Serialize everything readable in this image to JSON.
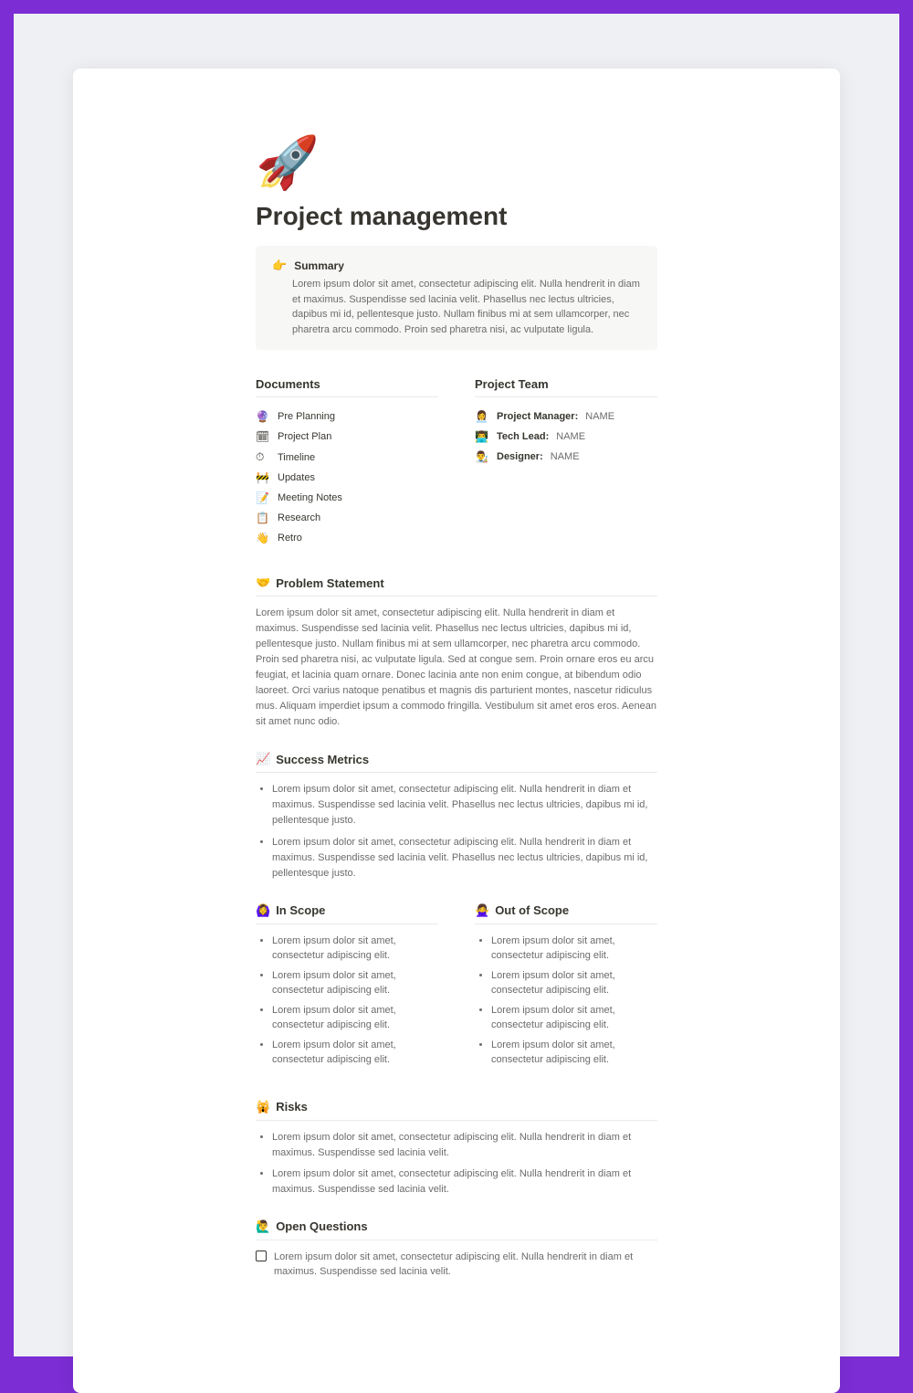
{
  "page": {
    "icon": "🚀",
    "title": "Project management"
  },
  "summary": {
    "icon": "👉",
    "title": "Summary",
    "text": "Lorem ipsum dolor sit amet, consectetur adipiscing elit. Nulla hendrerit in diam et maximus. Suspendisse sed lacinia velit. Phasellus nec lectus ultricies, dapibus mi id, pellentesque justo. Nullam finibus mi at sem ullamcorper, nec pharetra arcu commodo. Proin sed pharetra nisi, ac vulputate ligula."
  },
  "documents": {
    "heading": "Documents",
    "items": [
      {
        "icon": "🔮",
        "label": "Pre Planning"
      },
      {
        "icon": "🗓",
        "label": "Project Plan"
      },
      {
        "icon": "⏱",
        "label": "Timeline"
      },
      {
        "icon": "🚧",
        "label": "Updates"
      },
      {
        "icon": "📝",
        "label": "Meeting Notes"
      },
      {
        "icon": "📋",
        "label": "Research"
      },
      {
        "icon": "👋",
        "label": "Retro"
      }
    ]
  },
  "team": {
    "heading": "Project Team",
    "items": [
      {
        "icon": "👩‍💼",
        "role": "Project Manager:",
        "name": "NAME"
      },
      {
        "icon": "👨‍💻",
        "role": "Tech Lead:",
        "name": "NAME"
      },
      {
        "icon": "👨‍🎨",
        "role": "Designer:",
        "name": "NAME"
      }
    ]
  },
  "problem": {
    "icon": "🤝",
    "heading": "Problem Statement",
    "text": "Lorem ipsum dolor sit amet, consectetur adipiscing elit. Nulla hendrerit in diam et maximus. Suspendisse sed lacinia velit. Phasellus nec lectus ultricies, dapibus mi id, pellentesque justo. Nullam finibus mi at sem ullamcorper, nec pharetra arcu commodo. Proin sed pharetra nisi, ac vulputate ligula. Sed at congue sem. Proin ornare eros eu arcu feugiat, et lacinia quam ornare. Donec lacinia ante non enim congue, at bibendum odio laoreet. Orci varius natoque penatibus et magnis dis parturient montes, nascetur ridiculus mus. Aliquam imperdiet ipsum a commodo fringilla. Vestibulum sit amet eros eros. Aenean sit amet nunc odio."
  },
  "success": {
    "icon": "📈",
    "heading": "Success Metrics",
    "items": [
      "Lorem ipsum dolor sit amet, consectetur adipiscing elit. Nulla hendrerit in diam et maximus. Suspendisse sed lacinia velit. Phasellus nec lectus ultricies, dapibus mi id, pellentesque justo.",
      "Lorem ipsum dolor sit amet, consectetur adipiscing elit. Nulla hendrerit in diam et maximus. Suspendisse sed lacinia velit. Phasellus nec lectus ultricies, dapibus mi id, pellentesque justo."
    ]
  },
  "inscope": {
    "icon": "🙆‍♀️",
    "heading": "In Scope",
    "items": [
      "Lorem ipsum dolor sit amet, consectetur adipiscing elit.",
      "Lorem ipsum dolor sit amet, consectetur adipiscing elit.",
      "Lorem ipsum dolor sit amet, consectetur adipiscing elit.",
      "Lorem ipsum dolor sit amet, consectetur adipiscing elit."
    ]
  },
  "outscope": {
    "icon": "🙅‍♀️",
    "heading": "Out of Scope",
    "items": [
      "Lorem ipsum dolor sit amet, consectetur adipiscing elit.",
      "Lorem ipsum dolor sit amet, consectetur adipiscing elit.",
      "Lorem ipsum dolor sit amet, consectetur adipiscing elit.",
      "Lorem ipsum dolor sit amet, consectetur adipiscing elit."
    ]
  },
  "risks": {
    "icon": "🙀",
    "heading": "Risks",
    "items": [
      "Lorem ipsum dolor sit amet, consectetur adipiscing elit. Nulla hendrerit in diam et maximus. Suspendisse sed lacinia velit.",
      "Lorem ipsum dolor sit amet, consectetur adipiscing elit. Nulla hendrerit in diam et maximus. Suspendisse sed lacinia velit."
    ]
  },
  "questions": {
    "icon": "🙋‍♂️",
    "heading": "Open Questions",
    "items": [
      "Lorem ipsum dolor sit amet, consectetur adipiscing elit. Nulla hendrerit in diam et maximus. Suspendisse sed lacinia velit."
    ]
  }
}
